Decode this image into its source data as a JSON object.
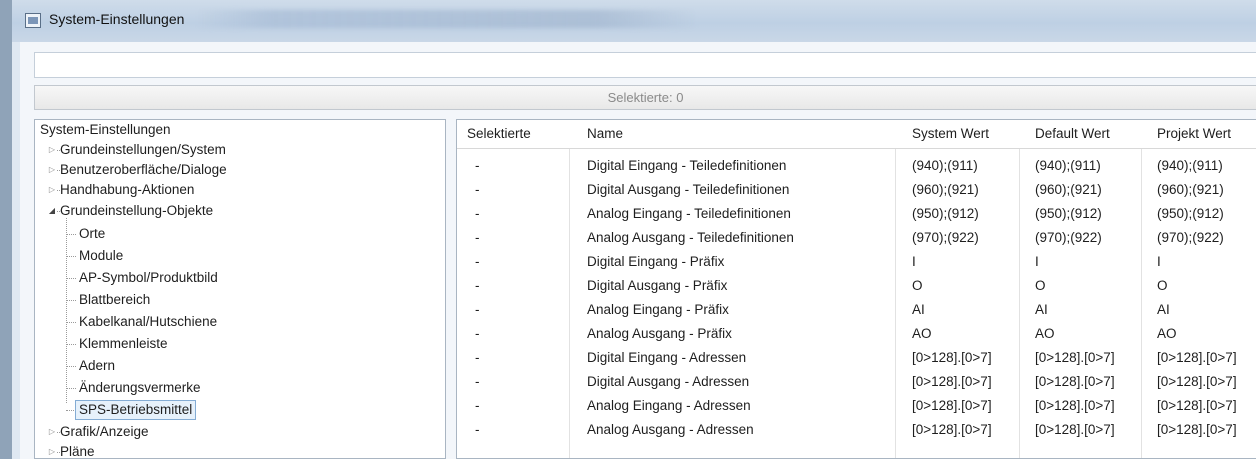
{
  "window": {
    "title": "System-Einstellungen"
  },
  "search": {
    "value": "",
    "placeholder": ""
  },
  "selection_bar": {
    "text": "Selektierte: 0"
  },
  "tree": {
    "root": "System-Einstellungen",
    "groups": [
      {
        "label": "Grundeinstellungen/System",
        "expanded": false
      },
      {
        "label": "Benutzeroberfläche/Dialoge",
        "expanded": false
      },
      {
        "label": "Handhabung-Aktionen",
        "expanded": false
      },
      {
        "label": "Grundeinstellung-Objekte",
        "expanded": true
      },
      {
        "label": "Grafik/Anzeige",
        "expanded": false
      },
      {
        "label": "Pläne",
        "expanded": false
      }
    ],
    "children": [
      "Orte",
      "Module",
      "AP-Symbol/Produktbild",
      "Blattbereich",
      "Kabelkanal/Hutschiene",
      "Klemmenleiste",
      "Adern",
      "Änderungsvermerke",
      "SPS-Betriebsmittel"
    ],
    "selected_child": "SPS-Betriebsmittel"
  },
  "table": {
    "columns": [
      "Selektierte",
      "Name",
      "System Wert",
      "Default Wert",
      "Projekt Wert"
    ],
    "rows": [
      [
        "-",
        "Digital Eingang - Teiledefinitionen",
        "(940);(911)",
        "(940);(911)",
        "(940);(911)"
      ],
      [
        "-",
        "Digital Ausgang - Teiledefinitionen",
        "(960);(921)",
        "(960);(921)",
        "(960);(921)"
      ],
      [
        "-",
        "Analog Eingang - Teiledefinitionen",
        "(950);(912)",
        "(950);(912)",
        "(950);(912)"
      ],
      [
        "-",
        "Analog Ausgang - Teiledefinitionen",
        "(970);(922)",
        "(970);(922)",
        "(970);(922)"
      ],
      [
        "-",
        "Digital Eingang - Präfix",
        "I",
        "I",
        "I"
      ],
      [
        "-",
        "Digital Ausgang - Präfix",
        "O",
        "O",
        "O"
      ],
      [
        "-",
        "Analog Eingang - Präfix",
        "AI",
        "AI",
        "AI"
      ],
      [
        "-",
        "Analog Ausgang - Präfix",
        "AO",
        "AO",
        "AO"
      ],
      [
        "-",
        "Digital Eingang - Adressen",
        "[0>128].[0>7]",
        "[0>128].[0>7]",
        "[0>128].[0>7]"
      ],
      [
        "-",
        "Digital Ausgang - Adressen",
        "[0>128].[0>7]",
        "[0>128].[0>7]",
        "[0>128].[0>7]"
      ],
      [
        "-",
        "Analog Eingang - Adressen",
        "[0>128].[0>7]",
        "[0>128].[0>7]",
        "[0>128].[0>7]"
      ],
      [
        "-",
        "Analog Ausgang - Adressen",
        "[0>128].[0>7]",
        "[0>128].[0>7]",
        "[0>128].[0>7]"
      ]
    ]
  }
}
